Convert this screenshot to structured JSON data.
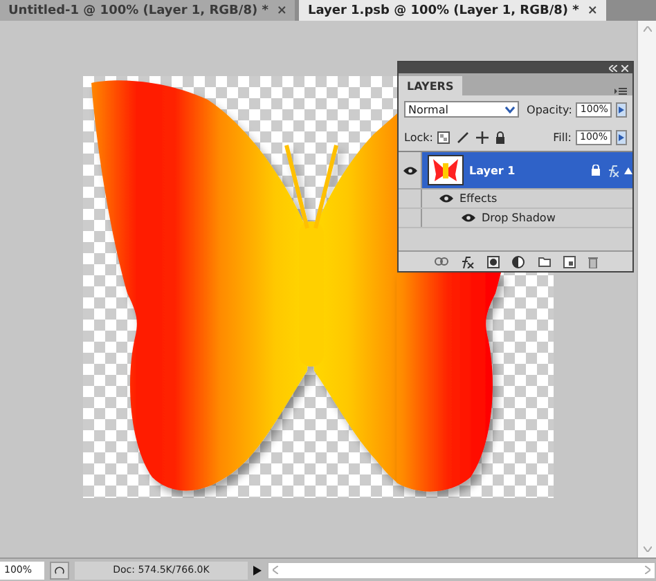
{
  "document_tabs": [
    {
      "label": "Untitled-1 @ 100% (Layer 1, RGB/8) *",
      "close": "×",
      "selected": false
    },
    {
      "label": "Layer 1.psb @ 100% (Layer 1, RGB/8) *",
      "close": "×",
      "selected": true
    }
  ],
  "layers_panel": {
    "tab": "LAYERS",
    "blend_mode": "Normal",
    "opacity_label": "Opacity:",
    "opacity": "100%",
    "lock_label": "Lock:",
    "fill_label": "Fill:",
    "fill": "100%",
    "layers": [
      {
        "name": "Layer 1",
        "selected": true,
        "visible": true,
        "effects_label": "Effects",
        "effects": [
          {
            "name": "Drop Shadow",
            "visible": true
          }
        ]
      }
    ]
  },
  "status_bar": {
    "zoom": "100%",
    "doc_info": "Doc: 574.5K/766.0K"
  }
}
